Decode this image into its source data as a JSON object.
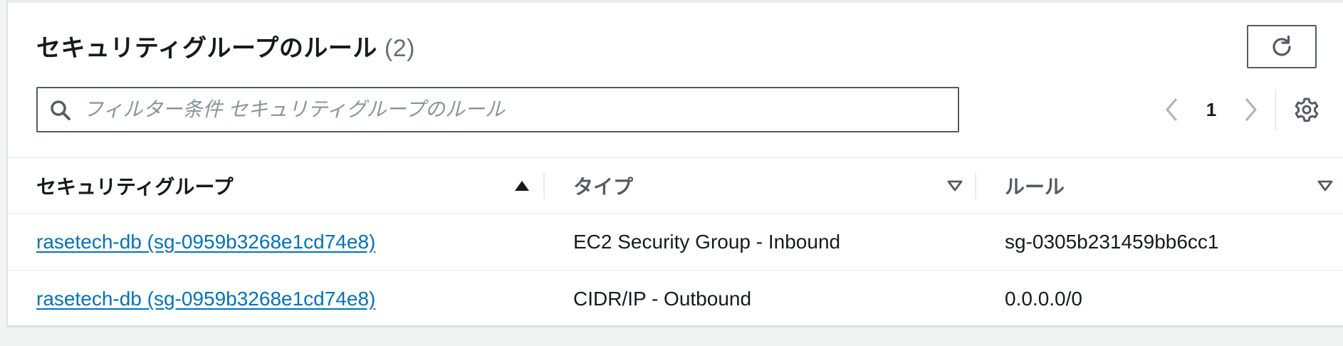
{
  "header": {
    "title": "セキュリティグループのルール",
    "count": "(2)"
  },
  "toolbar": {
    "refresh_icon": "refresh-icon",
    "settings_icon": "gear-icon"
  },
  "search": {
    "placeholder": "フィルター条件 セキュリティグループのルール",
    "value": "",
    "icon": "search-icon"
  },
  "pagination": {
    "current_page": "1",
    "prev_icon": "chevron-left-icon",
    "next_icon": "chevron-right-icon"
  },
  "table": {
    "columns": [
      {
        "label": "セキュリティグループ",
        "sort": "ascending"
      },
      {
        "label": "タイプ",
        "sort": "none"
      },
      {
        "label": "ルール",
        "sort": "none"
      }
    ],
    "rows": [
      {
        "security_group": "rasetech-db (sg-0959b3268e1cd74e8)",
        "type": "EC2 Security Group - Inbound",
        "rule": "sg-0305b231459bb6cc1"
      },
      {
        "security_group": "rasetech-db (sg-0959b3268e1cd74e8)",
        "type": "CIDR/IP - Outbound",
        "rule": "0.0.0.0/0"
      }
    ]
  },
  "colors": {
    "link": "#0073bb",
    "text": "#16191f",
    "muted": "#687078",
    "border": "#545b64"
  }
}
